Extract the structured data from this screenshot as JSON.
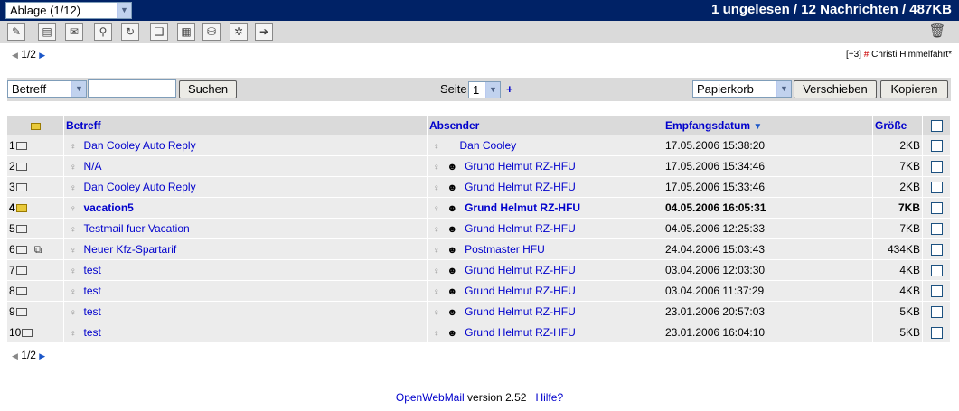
{
  "folder_select": {
    "value": "Ablage (1/12)"
  },
  "summary": "1 ungelesen / 12 Nachrichten / 487KB",
  "toolbar": {
    "buttons": [
      {
        "name": "compose-icon",
        "glyph": "✎"
      },
      {
        "name": "folders-icon",
        "glyph": "▤"
      },
      {
        "name": "addressbook-icon",
        "glyph": "✉"
      },
      {
        "name": "filter-icon",
        "glyph": "⚲"
      },
      {
        "name": "refresh-icon",
        "glyph": "↻"
      },
      {
        "name": "book-icon",
        "glyph": "❑"
      },
      {
        "name": "calendar-icon",
        "glyph": "▦"
      },
      {
        "name": "pop3-icon",
        "glyph": "⛁"
      },
      {
        "name": "preferences-icon",
        "glyph": "✲"
      },
      {
        "name": "logout-icon",
        "glyph": "➔"
      }
    ],
    "trash_glyph": "🗑"
  },
  "pager_top": {
    "label": "1/2"
  },
  "pager_bottom": {
    "label": "1/2"
  },
  "holiday": {
    "count": "[+3]",
    "hash": "#",
    "name": "Christi Himmelfahrt*"
  },
  "search": {
    "field_select": "Betreff",
    "query": "",
    "button": "Suchen",
    "page_label": "Seite",
    "page_value": "1",
    "plus": "+",
    "target_select": "Papierkorb",
    "move_button": "Verschieben",
    "copy_button": "Kopieren"
  },
  "table": {
    "headers": {
      "subject": "Betreff",
      "sender": "Absender",
      "date": "Empfangsdatum",
      "size": "Größe"
    },
    "rows": [
      {
        "num": "1",
        "status": "read",
        "attach": false,
        "subject": "Dan Cooley Auto Reply",
        "sender": "Dan Cooley",
        "person_icon": false,
        "date": "17.05.2006 15:38:20",
        "size": "2KB",
        "unread": false
      },
      {
        "num": "2",
        "status": "read",
        "attach": false,
        "subject": "N/A",
        "sender": "Grund Helmut RZ-HFU",
        "person_icon": true,
        "date": "17.05.2006 15:34:46",
        "size": "7KB",
        "unread": false
      },
      {
        "num": "3",
        "status": "read",
        "attach": false,
        "subject": "Dan Cooley Auto Reply",
        "sender": "Grund Helmut RZ-HFU",
        "person_icon": true,
        "date": "17.05.2006 15:33:46",
        "size": "2KB",
        "unread": false
      },
      {
        "num": "4",
        "status": "new",
        "attach": false,
        "subject": "vacation5",
        "sender": "Grund Helmut RZ-HFU",
        "person_icon": true,
        "date": "04.05.2006 16:05:31",
        "size": "7KB",
        "unread": true
      },
      {
        "num": "5",
        "status": "read",
        "attach": false,
        "subject": "Testmail fuer Vacation",
        "sender": "Grund Helmut RZ-HFU",
        "person_icon": true,
        "date": "04.05.2006 12:25:33",
        "size": "7KB",
        "unread": false
      },
      {
        "num": "6",
        "status": "read",
        "attach": true,
        "subject": "Neuer Kfz-Spartarif",
        "sender": "Postmaster HFU",
        "person_icon": true,
        "date": "24.04.2006 15:03:43",
        "size": "434KB",
        "unread": false
      },
      {
        "num": "7",
        "status": "read",
        "attach": false,
        "subject": "test",
        "sender": "Grund Helmut RZ-HFU",
        "person_icon": true,
        "date": "03.04.2006 12:03:30",
        "size": "4KB",
        "unread": false
      },
      {
        "num": "8",
        "status": "read",
        "attach": false,
        "subject": "test",
        "sender": "Grund Helmut RZ-HFU",
        "person_icon": true,
        "date": "03.04.2006 11:37:29",
        "size": "4KB",
        "unread": false
      },
      {
        "num": "9",
        "status": "read",
        "attach": false,
        "subject": "test",
        "sender": "Grund Helmut RZ-HFU",
        "person_icon": true,
        "date": "23.01.2006 20:57:03",
        "size": "5KB",
        "unread": false
      },
      {
        "num": "10",
        "status": "read",
        "attach": false,
        "subject": "test",
        "sender": "Grund Helmut RZ-HFU",
        "person_icon": true,
        "date": "23.01.2006 16:04:10",
        "size": "5KB",
        "unread": false
      }
    ]
  },
  "footer": {
    "app": "OpenWebMail",
    "version_text": "version 2.52",
    "help": "Hilfe?"
  }
}
